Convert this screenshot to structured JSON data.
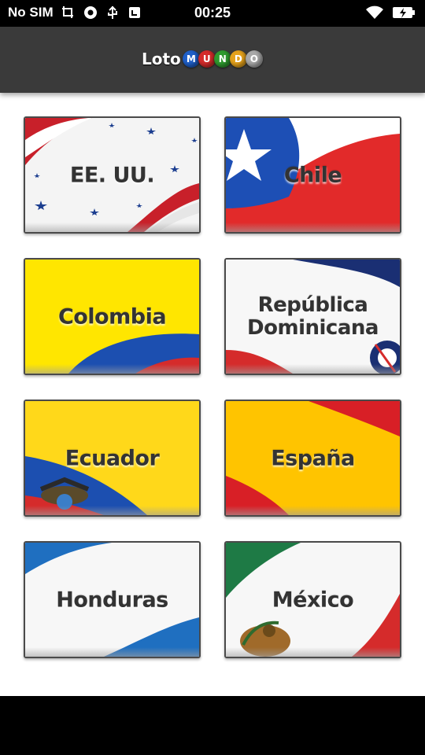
{
  "status_bar": {
    "carrier": "No SIM",
    "time": "00:25"
  },
  "app_bar": {
    "logo_word": "Loto",
    "logo_balls": [
      {
        "letter": "M",
        "color": "#1f5fc8"
      },
      {
        "letter": "U",
        "color": "#d42b2b"
      },
      {
        "letter": "N",
        "color": "#2f9b2f"
      },
      {
        "letter": "D",
        "color": "#e4a11b"
      },
      {
        "letter": "O",
        "color": "#a8a8a8"
      }
    ]
  },
  "countries": [
    {
      "label": "EE. UU."
    },
    {
      "label": "Chile"
    },
    {
      "label": "Colombia"
    },
    {
      "label": "República Dominicana"
    },
    {
      "label": "Ecuador"
    },
    {
      "label": "España"
    },
    {
      "label": "Honduras"
    },
    {
      "label": "México"
    }
  ]
}
